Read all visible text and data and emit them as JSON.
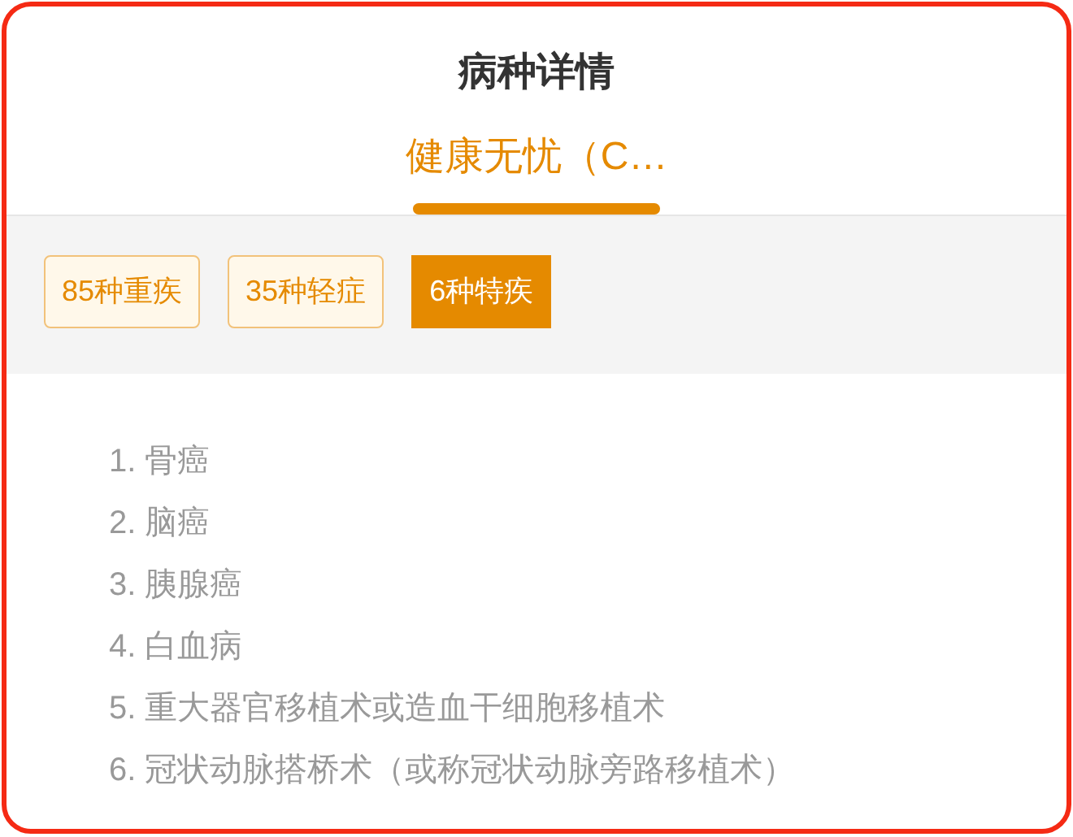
{
  "title": "病种详情",
  "plans": [
    {
      "label": "健康无忧（C…",
      "selected": true
    }
  ],
  "categories": [
    {
      "label": "85种重疾",
      "selected": false
    },
    {
      "label": "35种轻症",
      "selected": false
    },
    {
      "label": "6种特疾",
      "selected": true
    }
  ],
  "diseases": [
    "1. 骨癌",
    "2. 脑癌",
    "3. 胰腺癌",
    "4. 白血病",
    "5. 重大器官移植术或造血干细胞移植术",
    "6. 冠状动脉搭桥术（或称冠状动脉旁路移植术）"
  ]
}
